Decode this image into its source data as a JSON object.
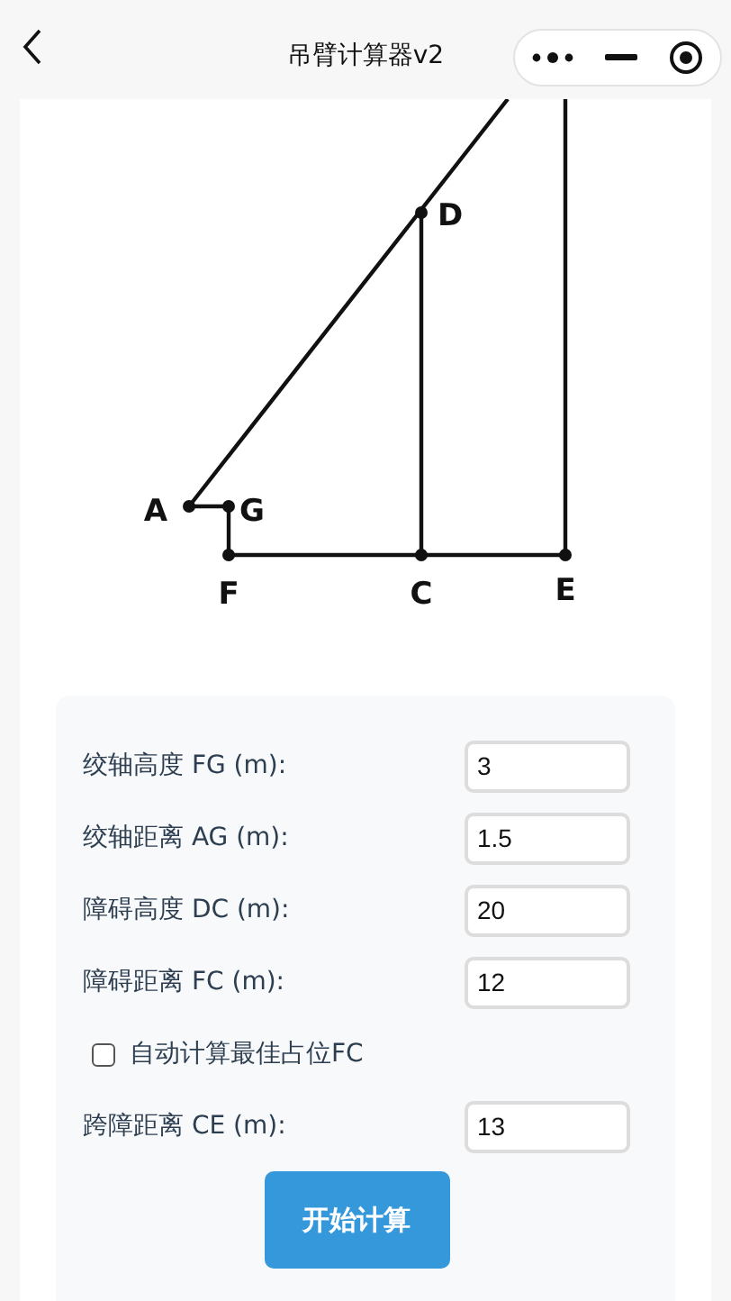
{
  "nav": {
    "title": "吊臂计算器v2"
  },
  "diagram": {
    "labels": [
      "A",
      "G",
      "D",
      "F",
      "C",
      "E"
    ]
  },
  "form": {
    "rows": [
      {
        "kind": "field",
        "label": "绞轴高度 FG (m):",
        "value": "3"
      },
      {
        "kind": "field",
        "label": "绞轴距离 AG (m):",
        "value": "1.5"
      },
      {
        "kind": "field",
        "label": "障碍高度 DC (m):",
        "value": "20"
      },
      {
        "kind": "field",
        "label": "障碍距离 FC (m):",
        "value": "12"
      },
      {
        "kind": "checkbox",
        "label": "自动计算最佳占位FC",
        "checked": false
      },
      {
        "kind": "field",
        "label": "跨障距离 CE (m):",
        "value": "13"
      }
    ],
    "button": "开始计算"
  }
}
